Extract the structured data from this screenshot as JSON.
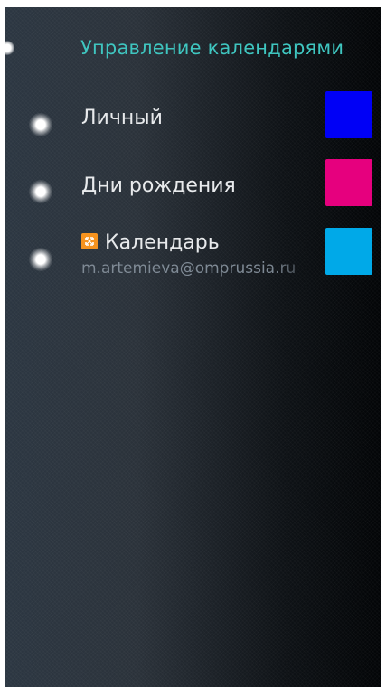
{
  "header": {
    "title": "Управление календарями"
  },
  "calendars": [
    {
      "label": "Личный",
      "color": "#0000f6"
    },
    {
      "label": "Дни рождения",
      "color": "#e6007e"
    },
    {
      "label": "Календарь",
      "account": "m.artemieva@omprussia.ru",
      "icon": "exchange-icon",
      "color": "#00a9e8"
    }
  ]
}
